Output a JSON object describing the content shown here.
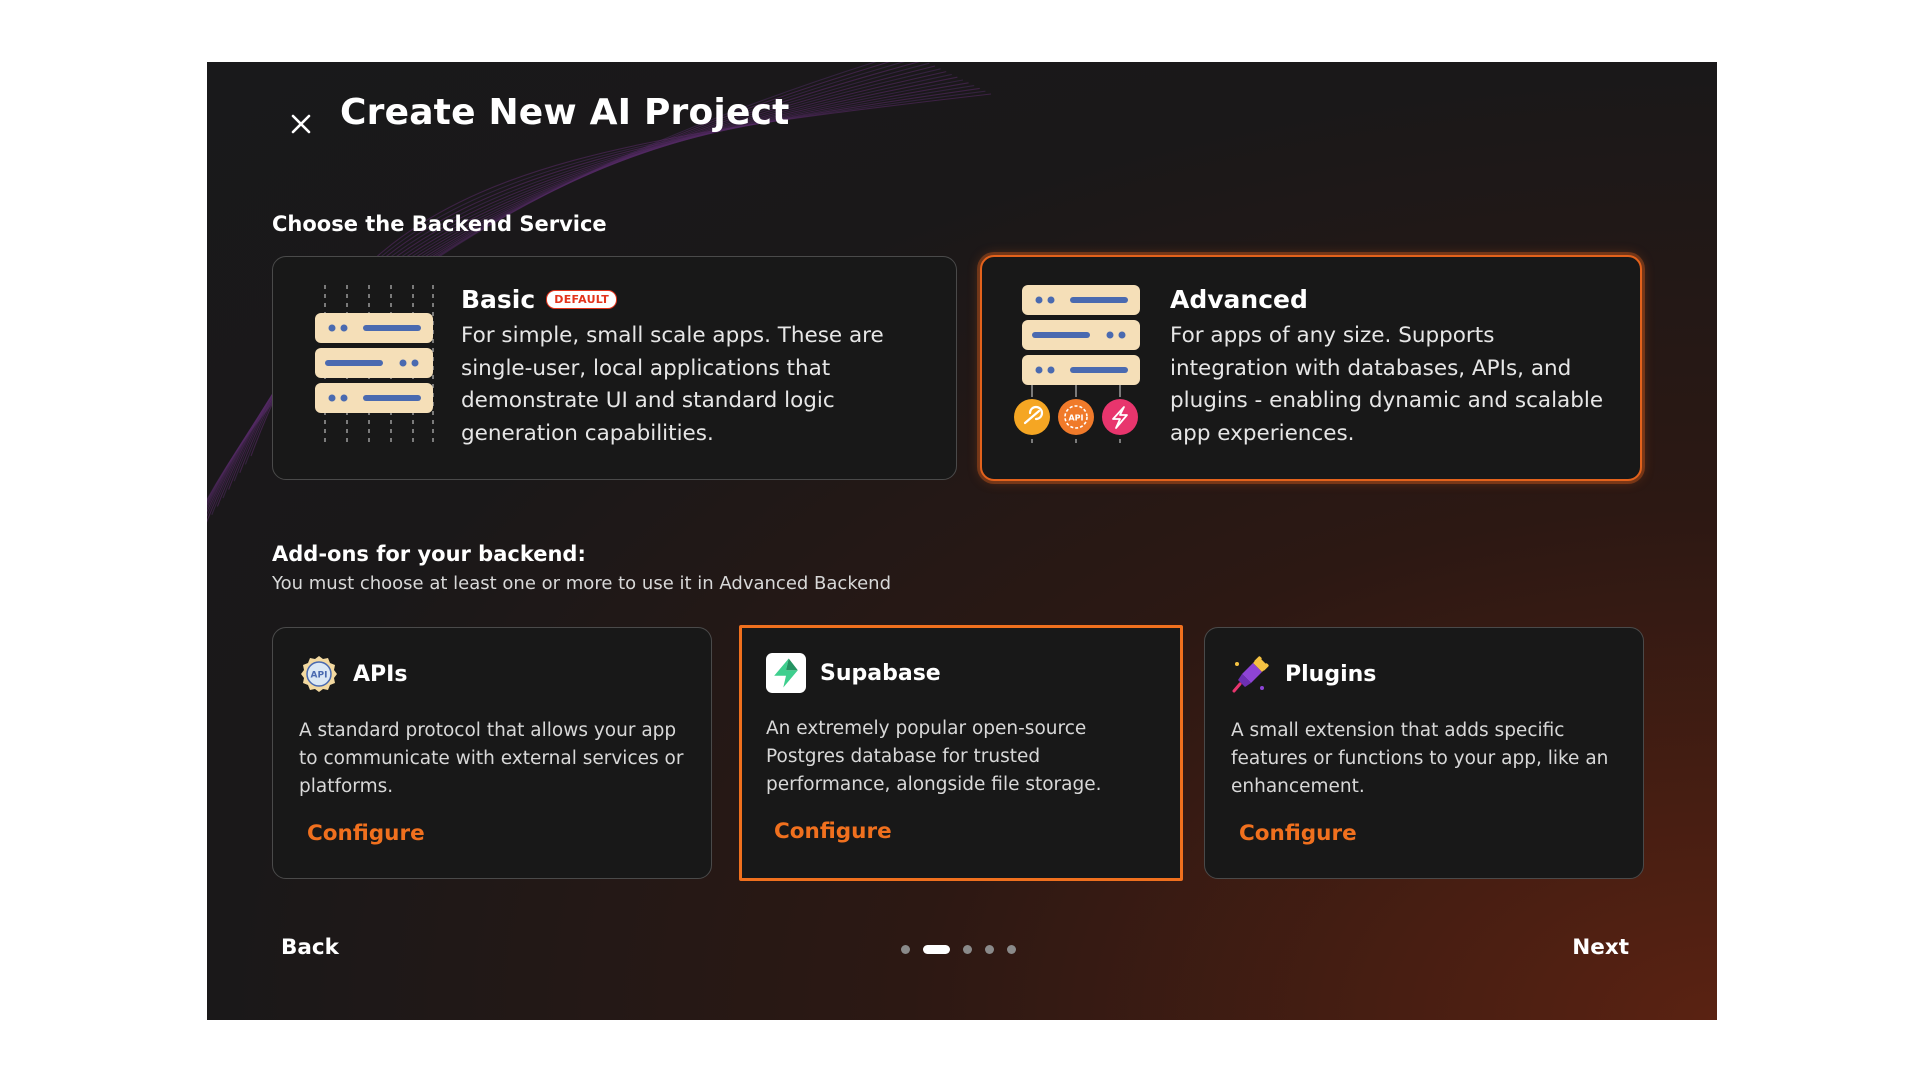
{
  "header": {
    "title": "Create New AI Project",
    "close_icon": "close-icon"
  },
  "backend": {
    "section_title": "Choose the Backend Service",
    "options": [
      {
        "name": "Basic",
        "badge": "DEFAULT",
        "description": "For simple, small scale apps. These are single-user, local applications that demonstrate UI and standard logic generation capabilities.",
        "icon": "server-stack-icon",
        "selected": false
      },
      {
        "name": "Advanced",
        "description": "For apps of any size. Supports integration with databases, APIs, and plugins - enabling dynamic and scalable app experiences.",
        "icon": "server-stack-integrations-icon",
        "selected": true
      }
    ]
  },
  "addons": {
    "section_title": "Add-ons for your backend:",
    "subtitle": "You must choose at least one or more to use it in Advanced Backend",
    "items": [
      {
        "name": "APIs",
        "description": "A standard protocol that allows your app to communicate with external services or platforms.",
        "configure_label": "Configure",
        "icon": "api-badge-icon",
        "selected": false
      },
      {
        "name": "Supabase",
        "description": "An extremely popular open-source Postgres database for trusted performance, alongside file storage.",
        "configure_label": "Configure",
        "icon": "supabase-bolt-icon",
        "selected": true
      },
      {
        "name": "Plugins",
        "description": "A small extension that adds specific features or functions to your app, like an enhancement.",
        "configure_label": "Configure",
        "icon": "puzzle-plug-icon",
        "selected": false
      }
    ]
  },
  "footer": {
    "back_label": "Back",
    "next_label": "Next",
    "steps_total": 5,
    "current_step": 2
  },
  "colors": {
    "accent": "#f0701e",
    "badge_red": "#e3341c",
    "card_bg": "#181818",
    "modal_bg": "#19191b"
  }
}
